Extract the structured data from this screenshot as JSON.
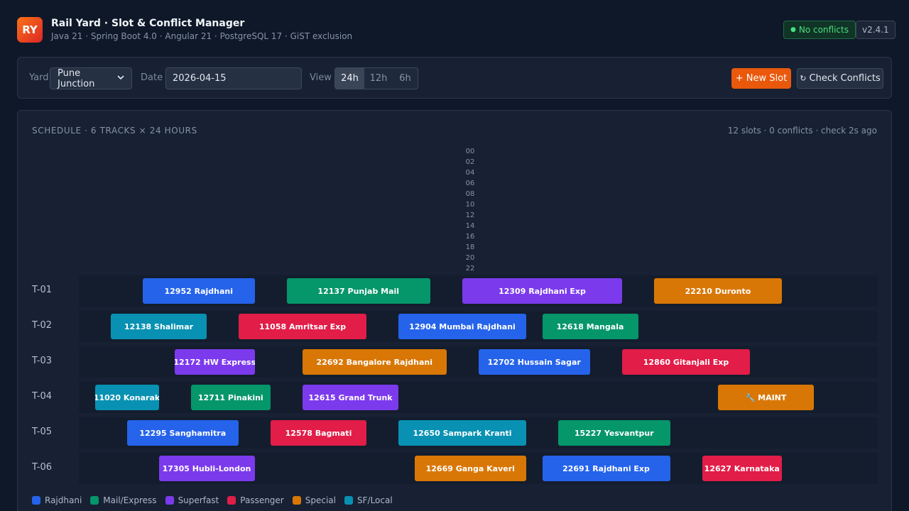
{
  "header": {
    "logo_text": "RY",
    "title": "Rail Yard · Slot & Conflict Manager",
    "subtitle": "Java 21 · Spring Boot 4.0 · Angular 21 · PostgreSQL 17 · GiST exclusion",
    "status_dot": "●",
    "status_text": "No conflicts",
    "version": "v2.4.1"
  },
  "toolbar": {
    "yard_label": "Yard",
    "yard_value": "Pune Junction",
    "date_label": "Date",
    "date_value": "2026-04-15",
    "view_label": "View",
    "views": [
      "24h",
      "12h",
      "6h"
    ],
    "active_view": "24h",
    "new_slot_label": "+ New Slot",
    "check_icon": "↻",
    "check_label": "Check Conflicts"
  },
  "schedule": {
    "title": "SCHEDULE · 6 TRACKS × 24 HOURS",
    "stats": "12 slots · 0 conflicts · check 2s ago",
    "hour_labels": [
      "00",
      "02",
      "04",
      "06",
      "08",
      "10",
      "12",
      "14",
      "16",
      "18",
      "20",
      "22"
    ],
    "tracks": [
      {
        "label": "T-01",
        "slots": [
          {
            "name": "12952 Rajdhani",
            "start": 2.0,
            "end": 5.5,
            "type": "rajdhani"
          },
          {
            "name": "12137 Punjab Mail",
            "start": 6.5,
            "end": 11.0,
            "type": "mail"
          },
          {
            "name": "12309 Rajdhani Exp",
            "start": 12.0,
            "end": 17.0,
            "type": "superfast"
          },
          {
            "name": "22210 Duronto",
            "start": 18.0,
            "end": 22.0,
            "type": "special"
          }
        ]
      },
      {
        "label": "T-02",
        "slots": [
          {
            "name": "12138 Shalimar",
            "start": 1.0,
            "end": 4.0,
            "type": "sflocal"
          },
          {
            "name": "11058 Amritsar Exp",
            "start": 5.0,
            "end": 9.0,
            "type": "passenger"
          },
          {
            "name": "12904 Mumbai Rajdhani",
            "start": 10.0,
            "end": 14.0,
            "type": "rajdhani"
          },
          {
            "name": "12618 Mangala",
            "start": 14.5,
            "end": 17.5,
            "type": "mail"
          }
        ]
      },
      {
        "label": "T-03",
        "slots": [
          {
            "name": "12172 HW Express",
            "start": 3.0,
            "end": 5.5,
            "type": "superfast"
          },
          {
            "name": "22692 Bangalore Rajdhani",
            "start": 7.0,
            "end": 11.5,
            "type": "special"
          },
          {
            "name": "12702 Hussain Sagar",
            "start": 12.5,
            "end": 16.0,
            "type": "rajdhani"
          },
          {
            "name": "12860 Gitanjali Exp",
            "start": 17.0,
            "end": 21.0,
            "type": "passenger"
          }
        ]
      },
      {
        "label": "T-04",
        "slots": [
          {
            "name": "11020 Konarak",
            "start": 0.5,
            "end": 2.5,
            "type": "sflocal"
          },
          {
            "name": "12711 Pinakini",
            "start": 3.5,
            "end": 6.0,
            "type": "mail"
          },
          {
            "name": "12615 Grand Trunk",
            "start": 7.0,
            "end": 10.0,
            "type": "superfast"
          },
          {
            "name": "🔧 MAINT",
            "start": 20.0,
            "end": 23.0,
            "type": "special"
          }
        ]
      },
      {
        "label": "T-05",
        "slots": [
          {
            "name": "12295 Sanghamitra",
            "start": 1.5,
            "end": 5.0,
            "type": "rajdhani"
          },
          {
            "name": "12578 Bagmati",
            "start": 6.0,
            "end": 9.0,
            "type": "passenger"
          },
          {
            "name": "12650 Sampark Kranti",
            "start": 10.0,
            "end": 14.0,
            "type": "sflocal"
          },
          {
            "name": "15227 Yesvantpur",
            "start": 15.0,
            "end": 18.5,
            "type": "mail"
          }
        ]
      },
      {
        "label": "T-06",
        "slots": [
          {
            "name": "17305 Hubli-London",
            "start": 2.5,
            "end": 5.5,
            "type": "superfast"
          },
          {
            "name": "12669 Ganga Kaveri",
            "start": 10.5,
            "end": 14.0,
            "type": "special"
          },
          {
            "name": "22691 Rajdhani Exp",
            "start": 14.5,
            "end": 18.5,
            "type": "rajdhani"
          },
          {
            "name": "12627 Karnataka",
            "start": 19.5,
            "end": 22.0,
            "type": "passenger"
          }
        ]
      }
    ]
  },
  "legend": [
    {
      "key": "rajdhani",
      "label": "Rajdhani",
      "color": "#2563eb"
    },
    {
      "key": "mail",
      "label": "Mail/Express",
      "color": "#059669"
    },
    {
      "key": "superfast",
      "label": "Superfast",
      "color": "#7c3aed"
    },
    {
      "key": "passenger",
      "label": "Passenger",
      "color": "#e11d48"
    },
    {
      "key": "special",
      "label": "Special",
      "color": "#d97706"
    },
    {
      "key": "sflocal",
      "label": "SF/Local",
      "color": "#0891b2"
    }
  ]
}
